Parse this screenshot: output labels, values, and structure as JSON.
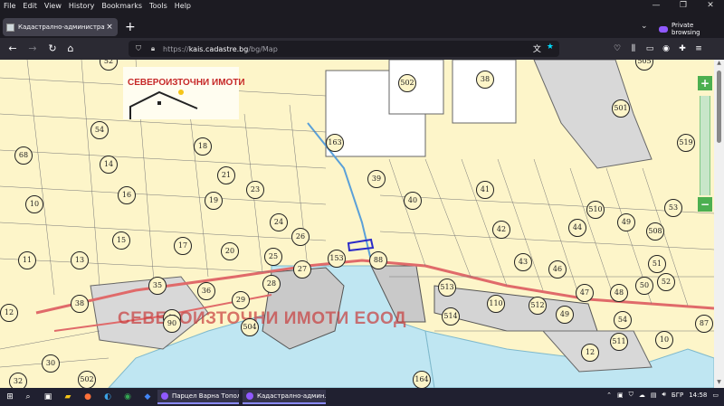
{
  "menubar": {
    "items": [
      "File",
      "Edit",
      "View",
      "History",
      "Bookmarks",
      "Tools",
      "Help"
    ]
  },
  "window": {
    "minimize_icon": "minimize-icon",
    "maximize_icon": "maximize-icon",
    "close_icon": "close-icon"
  },
  "tabs": [
    {
      "label": "Кадастрално-административ…",
      "close": "×"
    }
  ],
  "new_tab_label": "+",
  "private_label": "Private browsing",
  "nav": {
    "url_prefix": "https://",
    "url_host": "kais.cadastre.bg",
    "url_path": "/bg/Map"
  },
  "map": {
    "logo_text": "СЕВЕРОИЗТОЧНИ ИМОТИ",
    "watermark": "СЕВЕРОИЗТОЧНИ ИМОТИ ЕООД",
    "parcels": [
      {
        "n": "52"
      },
      {
        "n": "502"
      },
      {
        "n": "38"
      },
      {
        "n": "501"
      },
      {
        "n": "505"
      },
      {
        "n": "54"
      },
      {
        "n": "18"
      },
      {
        "n": "163"
      },
      {
        "n": "519"
      },
      {
        "n": "68"
      },
      {
        "n": "14"
      },
      {
        "n": "21"
      },
      {
        "n": "39"
      },
      {
        "n": "10"
      },
      {
        "n": "16"
      },
      {
        "n": "23"
      },
      {
        "n": "19"
      },
      {
        "n": "40"
      },
      {
        "n": "41"
      },
      {
        "n": "510"
      },
      {
        "n": "53"
      },
      {
        "n": "24"
      },
      {
        "n": "49"
      },
      {
        "n": "15"
      },
      {
        "n": "17"
      },
      {
        "n": "26"
      },
      {
        "n": "20"
      },
      {
        "n": "42"
      },
      {
        "n": "44"
      },
      {
        "n": "508"
      },
      {
        "n": "11"
      },
      {
        "n": "13"
      },
      {
        "n": "25"
      },
      {
        "n": "153"
      },
      {
        "n": "88"
      },
      {
        "n": "43"
      },
      {
        "n": "51"
      },
      {
        "n": "27"
      },
      {
        "n": "46"
      },
      {
        "n": "52"
      },
      {
        "n": "35"
      },
      {
        "n": "36"
      },
      {
        "n": "28"
      },
      {
        "n": "513"
      },
      {
        "n": "47"
      },
      {
        "n": "48"
      },
      {
        "n": "50"
      },
      {
        "n": "38"
      },
      {
        "n": "29"
      },
      {
        "n": "110"
      },
      {
        "n": "512"
      },
      {
        "n": "12"
      },
      {
        "n": "40"
      },
      {
        "n": "49"
      },
      {
        "n": "514"
      },
      {
        "n": "54"
      },
      {
        "n": "87"
      },
      {
        "n": "90"
      },
      {
        "n": "504"
      },
      {
        "n": "511"
      },
      {
        "n": "10"
      },
      {
        "n": "12"
      },
      {
        "n": "30"
      },
      {
        "n": "502"
      },
      {
        "n": "164"
      },
      {
        "n": "32"
      }
    ],
    "zoom_in": "+",
    "zoom_out": "−"
  },
  "taskbar": {
    "apps": [
      {
        "label": "Парцел Варна Топол…"
      },
      {
        "label": "Кадастрално-админ…"
      }
    ],
    "lang": "БГР",
    "time": "14:58"
  },
  "colors": {
    "land": "#fdf5c9",
    "sea": "#bfe6f2",
    "industrial": "#c9c9c9",
    "accent": "#9059ff"
  }
}
